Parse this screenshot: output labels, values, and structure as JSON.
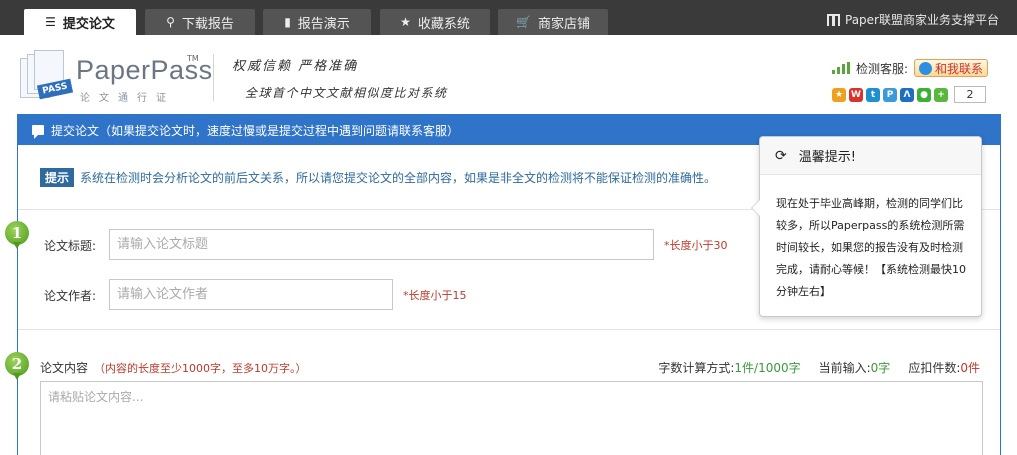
{
  "nav": {
    "tabs": [
      {
        "label": "提交论文",
        "icon": "document-icon",
        "active": true
      },
      {
        "label": "下载报告",
        "icon": "search-icon",
        "active": false
      },
      {
        "label": "报告演示",
        "icon": "file-icon",
        "active": false
      },
      {
        "label": "收藏系统",
        "icon": "star-icon",
        "active": false
      },
      {
        "label": "商家店铺",
        "icon": "cart-icon",
        "active": false
      }
    ],
    "brand": "Paper联盟商家业务支撑平台"
  },
  "header": {
    "logo_text": "PaperPass",
    "logo_tm": "TM",
    "logo_badge": "PASS",
    "logo_sub": "论文通行证",
    "slogan_line1": "权威信赖  严格准确",
    "slogan_line2": "全球首个中文文献相似度比对系统",
    "service_label": "检测客服:",
    "contact_label": "和我联系",
    "share_count": "2"
  },
  "panel": {
    "title": "提交论文（如果提交论文时，速度过慢或是提交过程中遇到问题请联系客服）",
    "tip_badge": "提示",
    "tip_text": "系统在检测时会分析论文的前后文关系，所以请您提交论文的全部内容，如果是非全文的检测将不能保证检测的准确性。",
    "step1": "1",
    "step2": "2",
    "title_label": "论文标题:",
    "title_placeholder": "请输入论文标题",
    "title_hint": "*长度小于30",
    "author_label": "论文作者:",
    "author_placeholder": "请输入论文作者",
    "author_hint": "*长度小于15",
    "content_label": "论文内容",
    "content_req": "（内容的长度至少1000字，至多10万字。）",
    "calc_label": "字数计算方式:",
    "calc_value": "1件/1000字",
    "current_label": "当前输入:",
    "current_value": "0字",
    "pieces_label": "应扣件数:",
    "pieces_value": "0件",
    "content_placeholder": "请粘贴论文内容..."
  },
  "popover": {
    "title": "温馨提示!",
    "body": "现在处于毕业高峰期，检测的同学们比较多，所以Paperpass的系统检测所需时间较长，如果您的报告没有及时检测完成，请耐心等候！【系统检测最快10分钟左右】"
  },
  "colors": {
    "accent": "#2f74c9",
    "nav_bg": "#3a3a3a",
    "step_green": "#4d9a1c",
    "hint_red": "#c0392b"
  }
}
